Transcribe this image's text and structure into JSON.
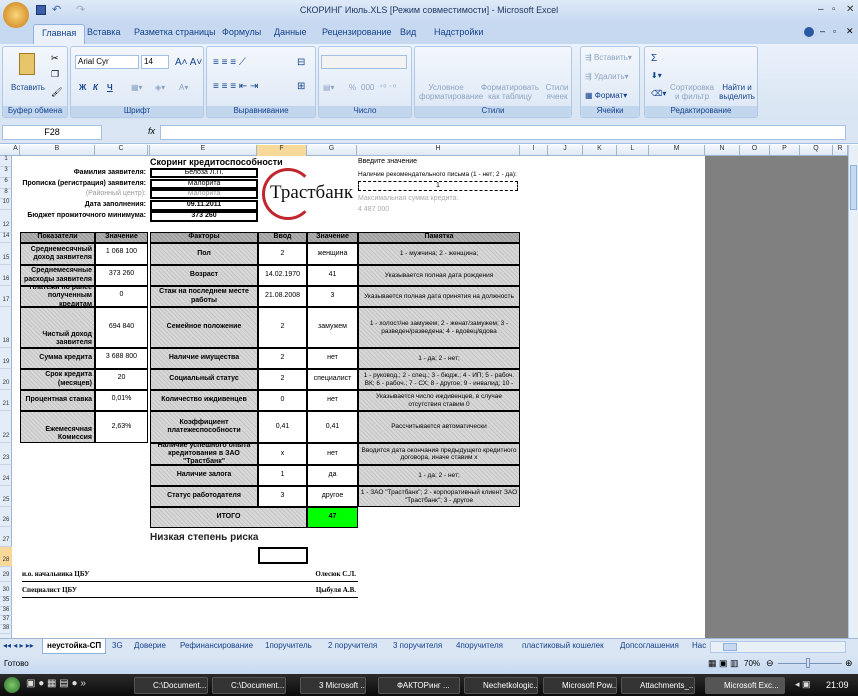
{
  "window": {
    "title": "СКОРИНГ Июль.XLS  [Режим совместимости] - Microsoft Excel"
  },
  "ribbon_tabs": [
    "Главная",
    "Вставка",
    "Разметка страницы",
    "Формулы",
    "Данные",
    "Рецензирование",
    "Вид",
    "Надстройки"
  ],
  "ribbon": {
    "clipboard": {
      "label": "Буфер обмена",
      "paste": "Вставить"
    },
    "font": {
      "label": "Шрифт",
      "font_name": "Arial Cyr",
      "font_size": "14",
      "bold": "Ж",
      "italic": "К",
      "underline": "Ч"
    },
    "alignment": {
      "label": "Выравнивание"
    },
    "number": {
      "label": "Число",
      "percent": "%",
      "thousands": "000"
    },
    "styles": {
      "label": "Стили",
      "conditional": "Условное форматирование",
      "as_table": "Форматировать как таблицу",
      "cell_styles": "Стили ячеек"
    },
    "cells": {
      "label": "Ячейки",
      "insert": "Вставить",
      "delete": "Удалить",
      "format": "Формат"
    },
    "editing": {
      "label": "Редактирование",
      "sort": "Сортировка и фильтр",
      "find": "Найти и выделить",
      "sum": "Σ"
    }
  },
  "formula_bar": {
    "name_box": "F28",
    "fx": "fx",
    "value": ""
  },
  "columns": [
    "A",
    "B",
    "C",
    "D",
    "E",
    "F",
    "G",
    "H",
    "I",
    "J",
    "K",
    "L",
    "M",
    "N",
    "O",
    "P",
    "Q",
    "R"
  ],
  "rows": [
    "1",
    "3",
    "6",
    "8",
    "10",
    "12",
    "14",
    "15",
    "16",
    "17",
    "18",
    "19",
    "20",
    "21",
    "22",
    "23",
    "24",
    "25",
    "26",
    "27",
    "28",
    "29",
    "30",
    "35",
    "36",
    "37",
    "38"
  ],
  "sheet": {
    "heading": "Скоринг кредитоспособности",
    "applicant": [
      {
        "label": "Фамилия заявителя:",
        "value": "Белоза Л.П."
      },
      {
        "label": "Прописка (регистрация) заявителя:",
        "value": "Малорита"
      },
      {
        "label": "(Районный центр):",
        "value": "Малорита"
      },
      {
        "label": "Дата заполнения:",
        "value": "09.11.2011"
      },
      {
        "label": "Бюджет прожиточного минимума:",
        "value": "373 260"
      }
    ],
    "logo_text": "Трастбанк",
    "side": {
      "enter_value": "Введите значение",
      "letter_label": "Наличие рекомендательного письма (1 - нет; 2 - да):",
      "letter_value": "1",
      "max_label": "Максимальная сумма кредита:",
      "max_value": "4 487 000"
    },
    "left_table": {
      "headers": [
        "Показатели",
        "Значение"
      ],
      "rows": [
        {
          "label": "Среднемесячный доход заявителя",
          "value": "1 068 100"
        },
        {
          "label": "Среднемесячные расходы заявителя",
          "value": "373 260"
        },
        {
          "label": "Платежи по ранее полученным кредитам",
          "value": "0"
        },
        {
          "label": "Чистый доход заявителя",
          "value": "694 840"
        },
        {
          "label": "Сумма кредита",
          "value": "3 688 800"
        },
        {
          "label": "Срок кредита (месяцев)",
          "value": "20"
        },
        {
          "label": "Процентная ставка",
          "value": "0,01%"
        },
        {
          "label": "Ежемесячная Комиссия",
          "value": "2,63%"
        }
      ]
    },
    "factors_table": {
      "headers": [
        "Факторы",
        "Ввод",
        "Значение",
        "Памятка"
      ],
      "rows": [
        {
          "factor": "Пол",
          "input": "2",
          "value": "женщина",
          "note": "1 - мужчина; 2 - женщина;"
        },
        {
          "factor": "Возраст",
          "input": "14.02.1970",
          "value": "41",
          "note": "Указывается полная дата рождения"
        },
        {
          "factor": "Стаж на последнем месте работы",
          "input": "21.08.2008",
          "value": "3",
          "note": "Указывается полная дата принятия на должность"
        },
        {
          "factor": "Семейное положение",
          "input": "2",
          "value": "замужем",
          "note": "1 - холост/не замужем; 2 - женат/замужем; 3 - разведен/разведена;  4 - вдовец/вдова"
        },
        {
          "factor": "Наличие имущества",
          "input": "2",
          "value": "нет",
          "note": "1 - да; 2 - нет;"
        },
        {
          "factor": "Социальный статус",
          "input": "2",
          "value": "специалист",
          "note": "1 - руковод.; 2 - спец.; 3 - бюдж.; 4 - ИП; 5 - рабоч. ВК; 6 - рабоч.; 7 - СХ; 8 - другое; 9 - инвалид; 10 -"
        },
        {
          "factor": "Количество иждивенцев",
          "input": "0",
          "value": "нет",
          "note": "Указывается число иждивенцев, в случае отсутствия ставим 0"
        },
        {
          "factor": "Коэффициент платежеспособности",
          "input": "0,41",
          "value": "0,41",
          "note": "Рассчитывается автоматически"
        },
        {
          "factor": "Наличие успешного опыта кредитования в ЗАО \"Трастбанк\"",
          "input": "x",
          "value": "нет",
          "note": "Вводится дата окончания предыдущего кредитного договора, иначе ставим x"
        },
        {
          "factor": "Наличие залога",
          "input": "1",
          "value": "да",
          "note": "1 - да; 2 - нет;"
        },
        {
          "factor": "Статус работодателя",
          "input": "3",
          "value": "другое",
          "note": "1 - ЗАО \"Трастбанк\"; 2 - корпоративный клиент ЗАО \"Трастбанк\"; 3 - другое"
        }
      ],
      "total_label": "ИТОГО",
      "total_value": "47"
    },
    "risk": "Низкая степень риска",
    "signatures": [
      {
        "role": "и.о. начальника ЦБУ",
        "name": "Олесюк С.Л."
      },
      {
        "role": "Специалист ЦБУ",
        "name": "Цыбуля А.В."
      }
    ],
    "colors": {
      "total_bg": "#00ff00",
      "header_bg": "#a6a6a6"
    }
  },
  "sheet_tabs": [
    "неустойка-СП",
    "3G",
    "Доверие",
    "Рефинансирование",
    "1поручитель",
    "2 поручителя",
    "3 поручителя",
    "4поручителя",
    "пластиковый кошелек",
    "Допсоглашения",
    "Нас"
  ],
  "status": {
    "ready": "Готово",
    "zoom": "70%"
  },
  "taskbar": {
    "items": [
      "C:\\Document...",
      "C:\\Document...",
      "3 Microsoft ...",
      "ФАКТОРинг ...",
      "Nechetkologic...",
      "Microsoft Pow...",
      "Attachments_...",
      "Microsoft Exc..."
    ],
    "clock": "21:09"
  }
}
